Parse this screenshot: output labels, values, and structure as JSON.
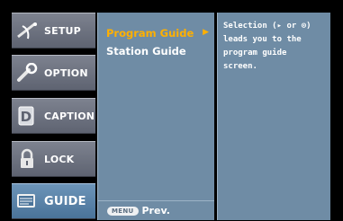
{
  "tabs": [
    {
      "label": "SETUP",
      "icon": "satellite-dish-icon"
    },
    {
      "label": "OPTION",
      "icon": "wrench-icon"
    },
    {
      "label": "CAPTION",
      "icon": "caption-d-icon"
    },
    {
      "label": "LOCK",
      "icon": "padlock-icon"
    },
    {
      "label": "GUIDE",
      "icon": "tv-guide-icon",
      "active": true
    }
  ],
  "menu": {
    "items": [
      "Program Guide",
      "Station Guide"
    ],
    "selected": "Program Guide",
    "footer_button": "MENU",
    "footer_label": "Prev."
  },
  "description": {
    "lines": [
      "Selection (▸ or ⊙)",
      "leads you to the",
      "program guide",
      "screen."
    ]
  },
  "colors": {
    "panel": "#6f8ca5",
    "highlight": "#ffb000",
    "active_tab": "#5a83a8"
  }
}
